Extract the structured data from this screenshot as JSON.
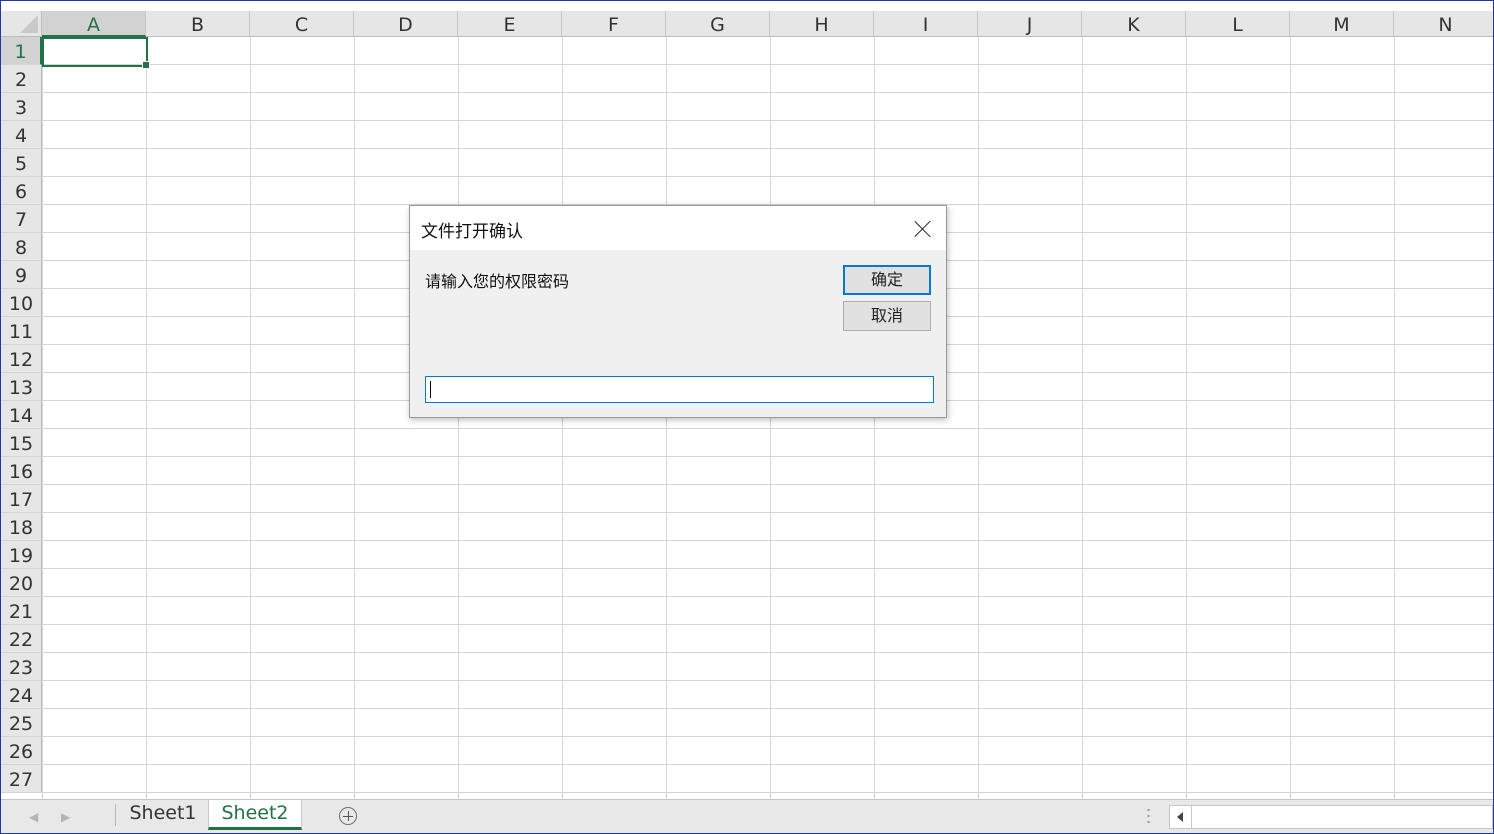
{
  "sheet": {
    "columns": [
      "A",
      "B",
      "C",
      "D",
      "E",
      "F",
      "G",
      "H",
      "I",
      "J",
      "K",
      "L",
      "M",
      "N"
    ],
    "rows": [
      "1",
      "2",
      "3",
      "4",
      "5",
      "6",
      "7",
      "8",
      "9",
      "10",
      "11",
      "12",
      "13",
      "14",
      "15",
      "16",
      "17",
      "18",
      "19",
      "20",
      "21",
      "22",
      "23",
      "24",
      "25",
      "26",
      "27"
    ],
    "selected_column": "A",
    "selected_row": "1"
  },
  "tabs": {
    "sheets": [
      "Sheet1",
      "Sheet2"
    ],
    "active": "Sheet2"
  },
  "dialog": {
    "title": "文件打开确认",
    "prompt": "请输入您的权限密码",
    "ok_label": "确定",
    "cancel_label": "取消",
    "input_value": ""
  },
  "colors": {
    "excel_green": "#217346",
    "focus_blue": "#0078d7"
  }
}
